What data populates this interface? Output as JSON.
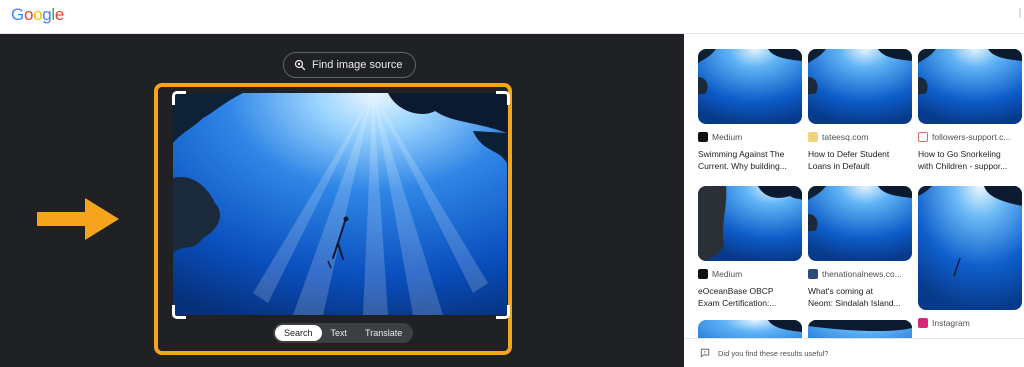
{
  "header": {
    "logo_letters": [
      "G",
      "o",
      "o",
      "g",
      "l",
      "e"
    ],
    "logo_colors": [
      "#4285F4",
      "#EA4335",
      "#FBBC05",
      "#4285F4",
      "#34A853",
      "#EA4335"
    ]
  },
  "lens": {
    "find_source_label": "Find image source",
    "tabs": [
      {
        "label": "Search",
        "active": true
      },
      {
        "label": "Text",
        "active": false
      },
      {
        "label": "Translate",
        "active": false
      }
    ],
    "highlight_color": "#F6A41C"
  },
  "results": [
    {
      "source": "Medium",
      "favicon": "medium-icon",
      "title_lines": [
        "Swimming Against The",
        "Current. Why building..."
      ]
    },
    {
      "source": "tateesq.com",
      "favicon": "tateesq-icon",
      "title_lines": [
        "How to Defer Student",
        "Loans in Default"
      ]
    },
    {
      "source": "followers-support.c...",
      "favicon": "followers-support-icon",
      "title_lines": [
        "How to Go Snorkeling",
        "with Children - suppor..."
      ]
    },
    {
      "source": "Medium",
      "favicon": "medium-icon",
      "title_lines": [
        "eOceanBase OBCP",
        "Exam Certification:..."
      ]
    },
    {
      "source": "thenationalnews.co...",
      "favicon": "thenationalnews-icon",
      "title_lines": [
        "What's coming at",
        "Neom: Sindalah Island..."
      ]
    },
    {
      "source": "Instagram",
      "favicon": "instagram-icon",
      "title_lines": [
        "",
        ""
      ]
    }
  ],
  "feedback": {
    "label": "Did you find these results useful?"
  }
}
